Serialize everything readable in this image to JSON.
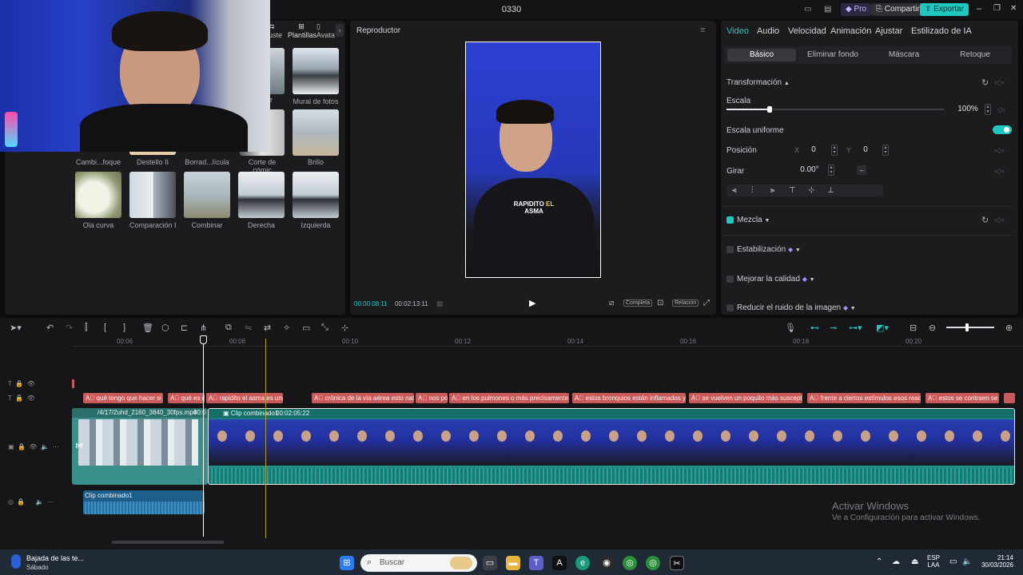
{
  "window": {
    "title": "0330",
    "pro_label": "Pro",
    "share_label": "Compartir",
    "export_label": "Exportar",
    "minimize": "–",
    "maximize": "❐",
    "close": "✕"
  },
  "left_panel": {
    "tabs": [
      "uste",
      "Plantillas",
      "Avata"
    ],
    "top_thumb_labels": [
      "Mural de fotos"
    ],
    "effects": [
      {
        "label": "Cambi...foque"
      },
      {
        "label": "Destello II"
      },
      {
        "label": "Borrad...lícula"
      },
      {
        "label": "Corte de cómic"
      },
      {
        "label": "Brillo"
      },
      {
        "label": "Ola curva"
      },
      {
        "label": "Comparación II"
      },
      {
        "label": "Combinar"
      },
      {
        "label": "Derecha"
      },
      {
        "label": "Izquierda"
      }
    ],
    "partial_label": "r"
  },
  "player": {
    "title": "Reproductor",
    "caption_line1": "RAPIDITO",
    "caption_highlight": "EL",
    "caption_line2": "ASMA",
    "current_time": "00:00:08:11",
    "total_time": "00:02:13:11",
    "full_label": "Completa",
    "ratio_label": "Relación"
  },
  "inspector": {
    "tabs": [
      "Video",
      "Audio",
      "Velocidad",
      "Animación",
      "Ajustar",
      "Estilizado de IA"
    ],
    "subtabs": [
      "Básico",
      "Eliminar fondo",
      "Máscara",
      "Retoque"
    ],
    "transform_label": "Transformación",
    "scale_label": "Escala",
    "scale_value": "100%",
    "scale_fraction": 0.2,
    "uniform_label": "Escala uniforme",
    "position_label": "Posición",
    "pos_x_label": "X",
    "pos_x_value": "0",
    "pos_y_label": "Y",
    "pos_y_value": "0",
    "rotate_label": "Girar",
    "rotate_value": "0.00°",
    "rotate_dash": "–",
    "blend_label": "Mezcla",
    "stabilize_label": "Estabilización",
    "quality_label": "Mejorar la calidad",
    "noise_label": "Reducir el ruido de la imagen"
  },
  "timeline": {
    "ruler": [
      "00:06",
      "00:08",
      "00:10",
      "00:12",
      "00:14",
      "00:16",
      "00:18",
      "00:20"
    ],
    "captions": [
      "qué tengo que hacer si me",
      "qué es el",
      "rapidito el asma es una er",
      "crónica de la vía aérea esto naturalm",
      "nos posi",
      "en los pulmones o más precisamente en los",
      "estos bronquios están inflamados y conv",
      "se vuelven un poquito más susceptibles",
      "frente a ciertos estímulos esos reaccion",
      "estos se contraen se inf"
    ],
    "clip1_label": "/4/17/2uhd_2160_3840_30fps.mp4",
    "clip1_time": "00:0",
    "clip2_label": "Clip combinado1",
    "clip2_time": "00:02:05:22",
    "audio_label": "Clip combinado1",
    "watermark_line1": "Activar Windows",
    "watermark_line2": "Ve a Configuración para activar Windows."
  },
  "taskbar": {
    "notif_title": "Bajada de las te...",
    "notif_sub": "Sábado",
    "search_placeholder": "Buscar",
    "lang1": "ESP",
    "lang2": "LAA",
    "time": "21:14",
    "date": "30/03/2026"
  },
  "colors": {
    "accent": "#1fc7c0",
    "caption_red": "#c85a5a",
    "clip_teal": "#1e8f86"
  }
}
